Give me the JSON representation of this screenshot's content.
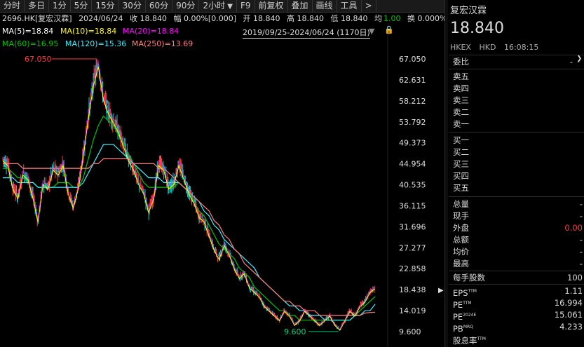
{
  "toolbar": {
    "items": [
      "分时",
      "多日",
      "1分",
      "5分",
      "15分",
      "30分",
      "60分",
      "90分",
      "2小时",
      "F9",
      "前复权",
      "叠加",
      "画线",
      "工具",
      ">"
    ]
  },
  "info": {
    "code": "2696.HK[复宏汉霖]",
    "date": "2024/06/24",
    "close": "收 18.840",
    "change": "幅 0.00%[0.000]",
    "open": "开 18.840",
    "high": "高 18.840",
    "low": "低 18.840",
    "avg_label": "均",
    "avg_value": "1.00",
    "turnover": "换 0.000%"
  },
  "ma": {
    "ma5": "MA(5)=18.84",
    "ma10": "MA(10)=18.84",
    "ma20": "MA(20)=18.84",
    "ma60": "MA(60)=16.95",
    "ma120": "MA(120)=15.36",
    "ma250": "MA(250)=13.69"
  },
  "range": "2019/09/25-2024/06/24 (1170日)",
  "chart_data": {
    "type": "candlestick",
    "y_ticks": [
      "67.050",
      "62.631",
      "58.212",
      "53.792",
      "49.373",
      "44.954",
      "40.535",
      "36.115",
      "31.696",
      "27.277",
      "22.858",
      "18.438",
      "14.019",
      "9.600"
    ],
    "ylim": [
      9.6,
      67.05
    ],
    "max_marker": "67.050",
    "min_marker": "9.600",
    "series": [
      {
        "name": "price",
        "values": [
          46,
          45,
          40,
          38,
          43,
          42,
          38,
          33,
          41,
          40,
          44,
          43,
          45,
          39,
          36,
          40,
          47,
          55,
          62,
          66,
          59,
          56,
          54,
          52,
          49,
          46,
          44,
          41,
          39,
          35,
          38,
          45,
          44,
          40,
          41,
          45,
          42,
          39,
          37,
          34,
          33,
          30,
          27,
          25,
          28,
          26,
          23,
          21,
          22,
          19,
          18,
          17,
          15,
          14,
          13,
          12,
          14,
          13,
          11,
          12,
          14,
          13,
          12,
          11,
          12,
          13,
          11,
          10,
          12,
          14,
          13,
          15,
          16,
          18,
          18.8
        ]
      },
      {
        "name": "MA(60)",
        "values": [
          44,
          44,
          43,
          42,
          42,
          41,
          41,
          40,
          40,
          40,
          40,
          41,
          41,
          41,
          40,
          40,
          42,
          46,
          50,
          53,
          55,
          54,
          53,
          51,
          49,
          47,
          45,
          43,
          41,
          40,
          40,
          40,
          40,
          40,
          40,
          41,
          40,
          39,
          37,
          35,
          34,
          32,
          30,
          28,
          27,
          26,
          25,
          23,
          22,
          21,
          19,
          18,
          17,
          16,
          15,
          14,
          14,
          13,
          13,
          12,
          12,
          12,
          12,
          12,
          12,
          12,
          12,
          12,
          12,
          12,
          13,
          14,
          15,
          16,
          16.95
        ]
      },
      {
        "name": "MA(120)",
        "values": [
          42,
          42,
          42,
          41,
          41,
          41,
          41,
          40,
          40,
          40,
          40,
          40,
          40,
          40,
          40,
          40,
          41,
          43,
          45,
          47,
          49,
          49,
          49,
          48,
          47,
          46,
          45,
          44,
          43,
          42,
          42,
          42,
          41,
          41,
          41,
          41,
          40,
          39,
          38,
          37,
          35,
          34,
          32,
          31,
          29,
          28,
          27,
          26,
          25,
          24,
          23,
          21,
          20,
          19,
          18,
          17,
          16,
          15,
          15,
          14,
          14,
          13,
          13,
          13,
          12,
          12,
          12,
          12,
          12,
          12,
          13,
          13,
          14,
          14,
          15.36
        ]
      },
      {
        "name": "MA(250)",
        "values": [
          45,
          45,
          45,
          45,
          44,
          44,
          44,
          44,
          44,
          44,
          44,
          44,
          44,
          44,
          44,
          44,
          44,
          44,
          45,
          45,
          46,
          46,
          46,
          46,
          46,
          46,
          45,
          45,
          45,
          45,
          45,
          44,
          44,
          43,
          42,
          41,
          40,
          39,
          38,
          37,
          36,
          35,
          33,
          32,
          30,
          29,
          27,
          26,
          24,
          23,
          22,
          21,
          20,
          19,
          18,
          17,
          16,
          16,
          15,
          15,
          14,
          14,
          14,
          13,
          13,
          13,
          13,
          13,
          13,
          13,
          13,
          13,
          13.5,
          13.6,
          13.69
        ]
      }
    ]
  },
  "panel": {
    "name": "复宏汉霖",
    "price": "18.840",
    "market": "HKEX",
    "currency": "HKD",
    "time": "16:08:15",
    "weibi_label": "委比",
    "weibi_value": "-",
    "sell": [
      "卖五",
      "卖四",
      "卖三",
      "卖二",
      "卖一"
    ],
    "buy": [
      "买一",
      "买二",
      "买三",
      "买四",
      "买五"
    ],
    "stats": [
      {
        "label": "总量",
        "value": "-"
      },
      {
        "label": "现手",
        "value": "-"
      },
      {
        "label": "外盘",
        "value": "0.00"
      },
      {
        "label": "总额",
        "value": "-"
      },
      {
        "label": "均价",
        "value": "-"
      },
      {
        "label": "最高",
        "value": "-"
      }
    ],
    "lot_label": "每手股数",
    "lot_value": "100",
    "eps_label": "EPS",
    "eps_value": "1.11",
    "pe_label": "PE",
    "pe_value": "16.994",
    "pe2_label": "PE",
    "pe2_sup": "2024E",
    "pe2_value": "15.061",
    "pb_label": "PB",
    "pb_sup": "MRQ",
    "pb_value": "4.233",
    "div_label": "股息率",
    "tm": "TTM"
  },
  "colors": {
    "up": "#ff3b3b",
    "down": "#00c8c8",
    "ma5": "#ffffff",
    "ma10": "#ffff00",
    "ma20": "#ff00ff",
    "ma60": "#00c000",
    "ma120": "#3cf0ff",
    "ma250": "#ff8080"
  }
}
